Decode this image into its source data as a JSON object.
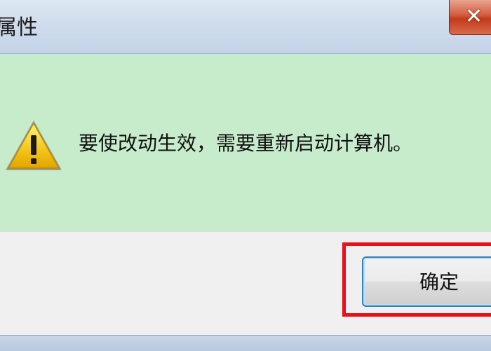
{
  "window": {
    "title": "属性",
    "close_glyph": "✕"
  },
  "dialog": {
    "icon": "warning-triangle-icon",
    "message": "要使改动生效，需要重新启动计算机。",
    "ok_label": "确定"
  },
  "colors": {
    "message_area_bg": "#c7eccc",
    "highlight": "#e8101a",
    "close_button": "#c33a1b"
  }
}
